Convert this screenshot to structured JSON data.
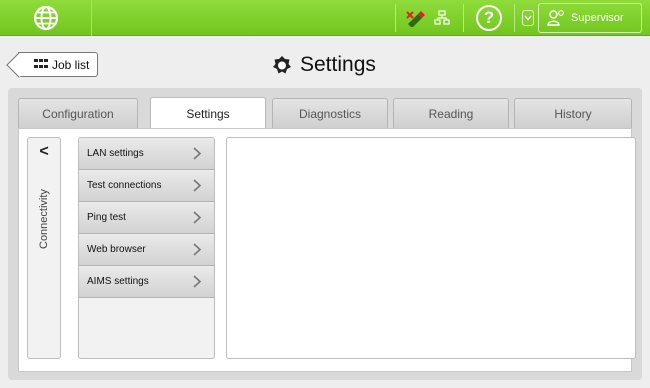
{
  "topbar": {
    "help_label": "?",
    "user_label": "Supervisor"
  },
  "header": {
    "back_label": "Job list",
    "title": "Settings"
  },
  "tabs": [
    {
      "label": "Configuration",
      "active": false
    },
    {
      "label": "Settings",
      "active": true
    },
    {
      "label": "Diagnostics",
      "active": false
    },
    {
      "label": "Reading",
      "active": false
    },
    {
      "label": "History",
      "active": false
    }
  ],
  "sidebar": {
    "back_glyph": "<",
    "section_label": "Connectivity"
  },
  "menu": {
    "items": [
      {
        "label": "LAN settings"
      },
      {
        "label": "Test connections"
      },
      {
        "label": "Ping test"
      },
      {
        "label": "Web browser"
      },
      {
        "label": "AIMS settings"
      }
    ]
  },
  "colors": {
    "topbar_green": "#7dd12a",
    "panel_grey": "#d9d9d9"
  }
}
